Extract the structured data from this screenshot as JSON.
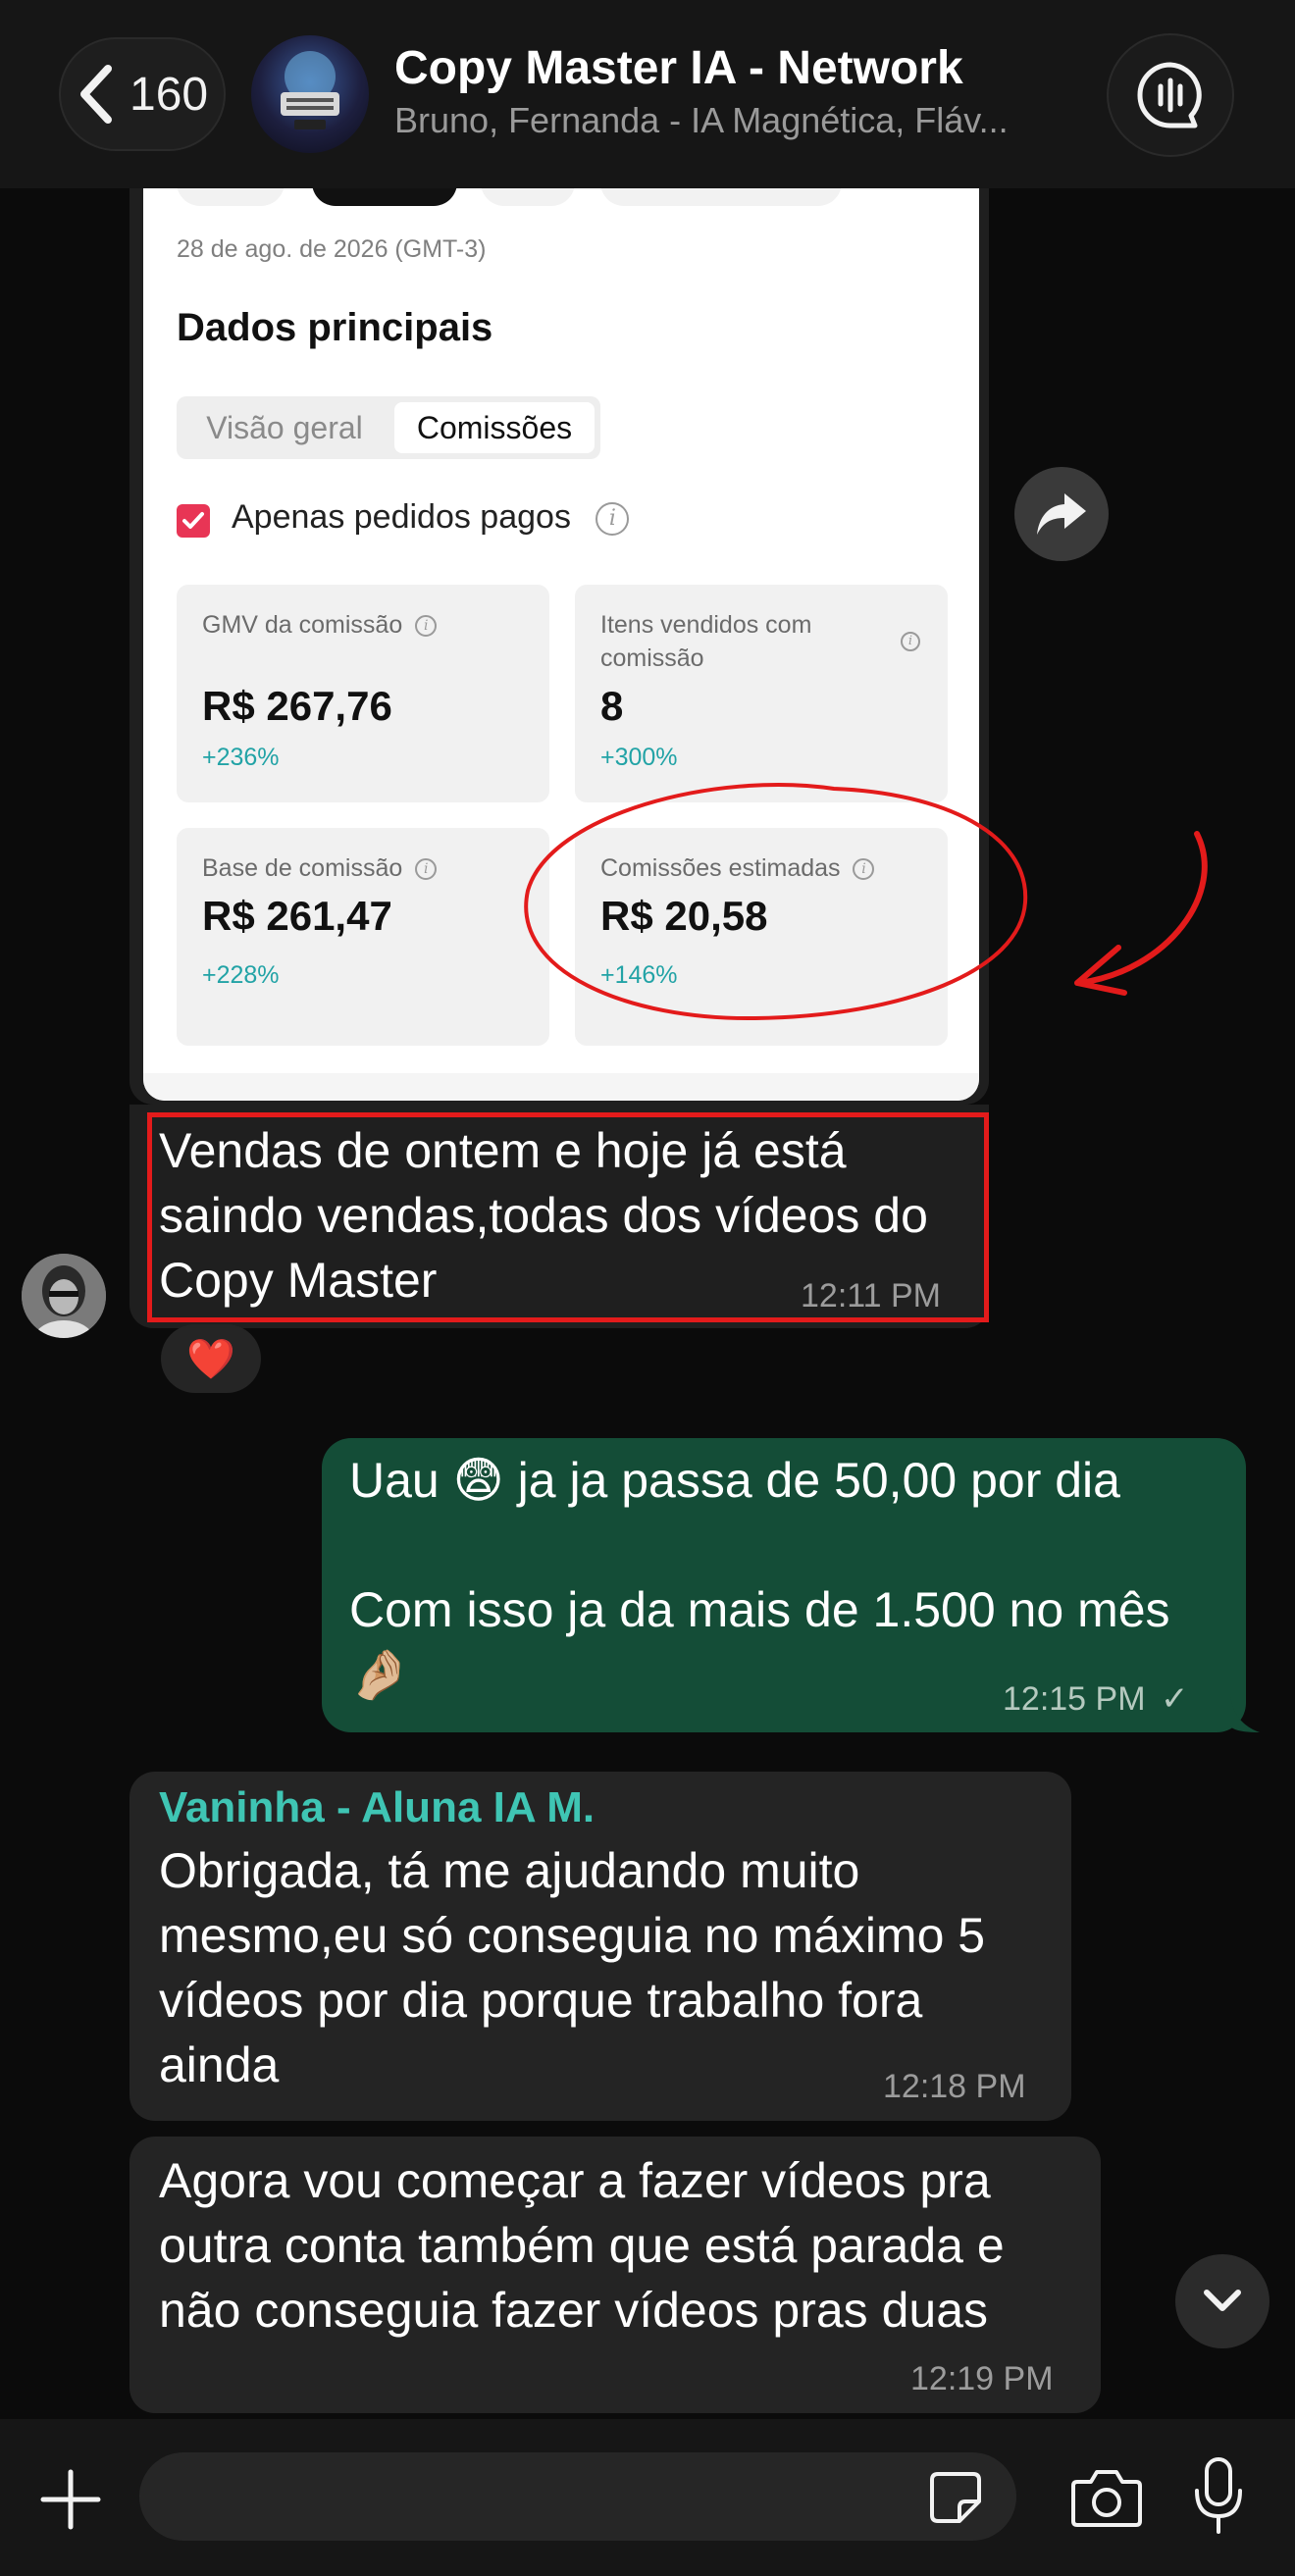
{
  "header": {
    "back_count": "160",
    "title": "Copy Master IA - Network",
    "subtitle": "Bruno, Fernanda - IA Magnética, Fláv..."
  },
  "screenshot_card": {
    "date": "28 de ago. de 2026 (GMT-3)",
    "section_title": "Dados principais",
    "tabs": [
      "Visão geral",
      "Comissões"
    ],
    "active_tab": "Comissões",
    "checkbox_label": "Apenas pedidos pagos",
    "checkbox_checked": true,
    "metrics": [
      {
        "label": "GMV da comissão",
        "value": "R$ 267,76",
        "delta": "+236%"
      },
      {
        "label": "Itens vendidos com comissão",
        "value": "8",
        "delta": "+300%"
      },
      {
        "label": "Base de comissão",
        "value": "R$ 261,47",
        "delta": "+228%"
      },
      {
        "label": "Comissões estimadas",
        "value": "R$ 20,58",
        "delta": "+146%"
      }
    ],
    "highlighted_metric": "Comissões estimadas",
    "annotation_color": "#e31b1b"
  },
  "messages": [
    {
      "direction": "incoming",
      "text": "Vendas de ontem e hoje já está saindo vendas,todas dos vídeos do Copy Master",
      "time": "12:11 PM",
      "reaction": "❤️"
    },
    {
      "direction": "outgoing",
      "line1": "Uau 😨 ja ja passa de 50,00 por dia",
      "line2": "Com isso ja da mais de 1.500 no mês 🤌🏼",
      "time": "12:15 PM",
      "status": "✓"
    },
    {
      "direction": "incoming",
      "sender": "Vaninha - Aluna IA M.",
      "text": "Obrigada, tá me ajudando muito mesmo,eu só conseguia no máximo 5 vídeos por dia porque trabalho fora ainda",
      "time": "12:18 PM"
    },
    {
      "direction": "incoming",
      "text": "Agora vou começar a fazer vídeos pra outra conta também que está parada e não conseguia fazer vídeos pras duas",
      "time": "12:19 PM"
    }
  ],
  "composer": {
    "placeholder": ""
  },
  "colors": {
    "background": "#0b0b0b",
    "outgoing_bubble": "#144d37",
    "incoming_bubble": "#242424",
    "sender_name": "#3fc5b4",
    "delta_text": "#22a3a6",
    "checkbox": "#e83555"
  },
  "icons": [
    "chevron-left-icon",
    "audio-call-icon",
    "forward-icon",
    "heart-icon",
    "plus-icon",
    "sticker-icon",
    "camera-icon",
    "microphone-icon",
    "chevron-down-icon"
  ]
}
